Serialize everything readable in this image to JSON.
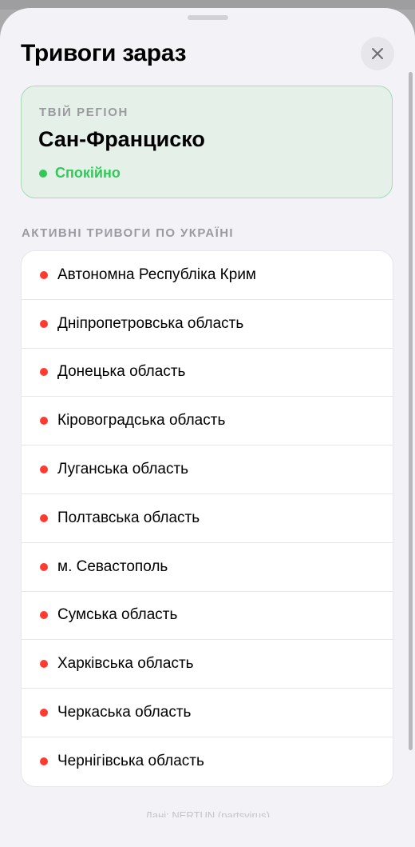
{
  "header": {
    "title": "Тривоги зараз",
    "close_icon": "close-icon"
  },
  "region": {
    "label": "ТВІЙ РЕГІОН",
    "name": "Сан-Франциско",
    "status": "Спокійно",
    "status_color": "#34c759"
  },
  "alerts": {
    "section_title": "АКТИВНІ ТРИВОГИ ПО УКРАЇНІ",
    "alert_color": "#ff3b30",
    "items": [
      "Автономна Республіка Крим",
      "Дніпропетровська область",
      "Донецька область",
      "Кіровоградська область",
      "Луганська область",
      "Полтавська область",
      "м. Севастополь",
      "Сумська область",
      "Харківська область",
      "Черкаська область",
      "Чернігівська область"
    ]
  },
  "footer": {
    "text": "Дані: NERTUN (partsvirus)"
  }
}
